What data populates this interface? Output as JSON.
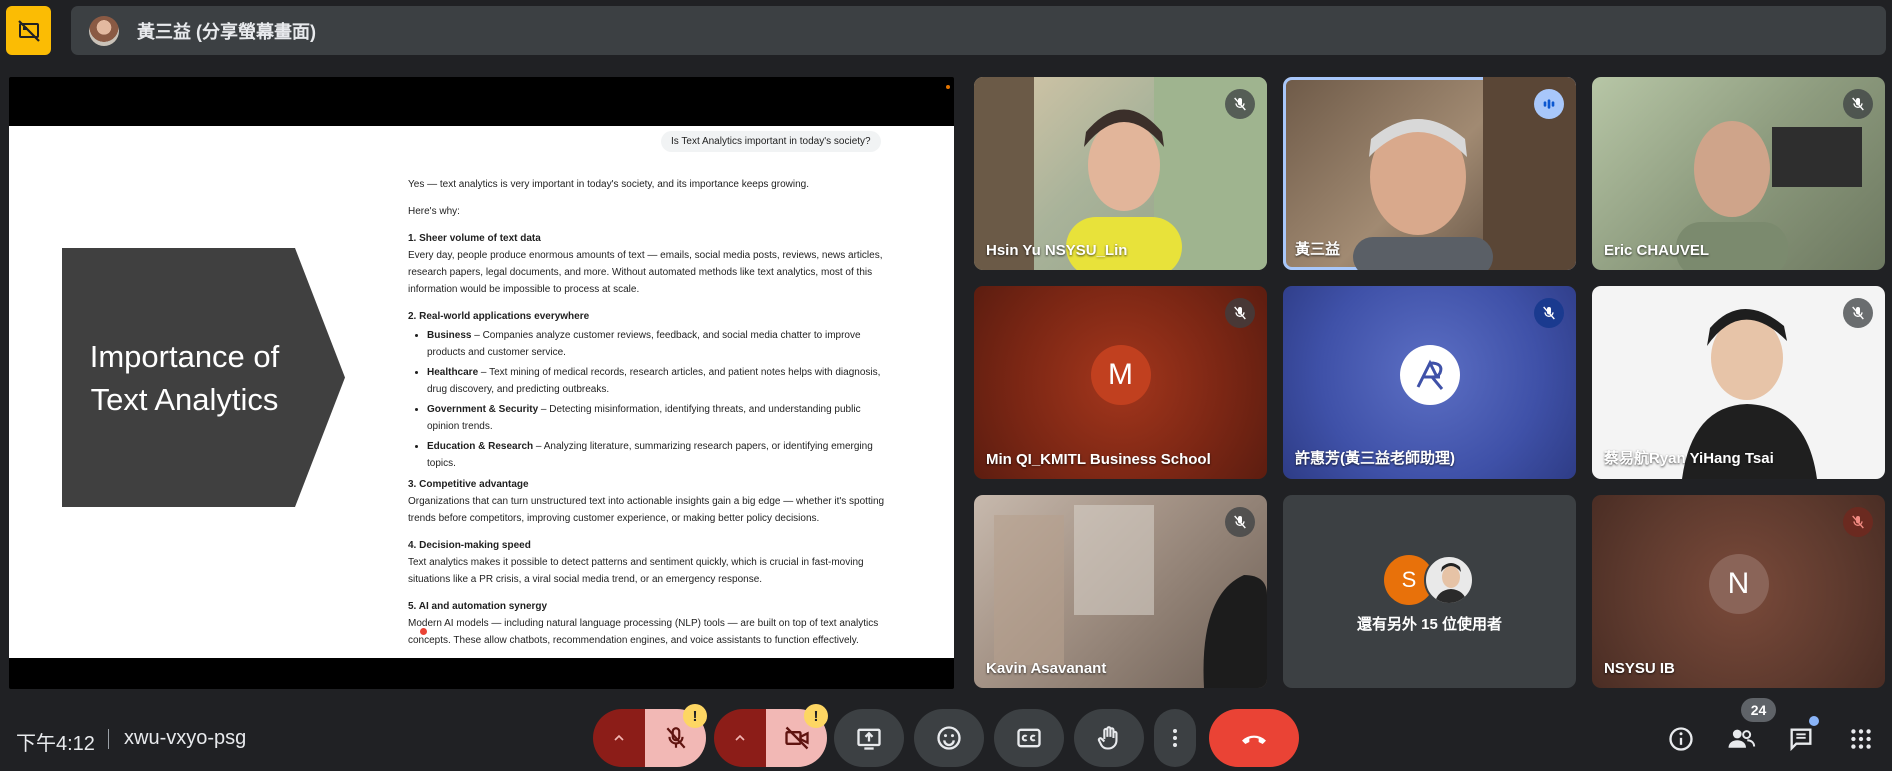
{
  "header": {
    "presenter_label": "黃三益 (分享螢幕畫面)"
  },
  "slide": {
    "title": "Importance of Text Analytics",
    "question": "Is Text Analytics important in today's society?",
    "intro": "Yes — text analytics is very important in today's society, and its importance keeps growing.",
    "why": "Here's why:",
    "sec1_title": "1. Sheer volume of text data",
    "sec1_body": "Every day, people produce enormous amounts of text — emails, social media posts, reviews, news articles, research papers, legal documents, and more. Without automated methods like text analytics, most of this information would be impossible to process at scale.",
    "sec2_title": "2. Real-world applications everywhere",
    "bullets": [
      {
        "term": "Business",
        "text": " – Companies analyze customer reviews, feedback, and social media chatter to improve products and customer service."
      },
      {
        "term": "Healthcare",
        "text": " – Text mining of medical records, research articles, and patient notes helps with diagnosis, drug discovery, and predicting outbreaks."
      },
      {
        "term": "Government & Security",
        "text": " – Detecting misinformation, identifying threats, and understanding public opinion trends."
      },
      {
        "term": "Education & Research",
        "text": " – Analyzing literature, summarizing research papers, or identifying emerging topics."
      }
    ],
    "sec3_title": "3. Competitive advantage",
    "sec3_body": "Organizations that can turn unstructured text into actionable insights gain a big edge — whether it's spotting trends before competitors, improving customer experience, or making better policy decisions.",
    "sec4_title": "4. Decision-making speed",
    "sec4_body": "Text analytics makes it possible to detect patterns and sentiment quickly, which is crucial in fast-moving situations like a PR crisis, a viral social media trend, or an emergency response.",
    "sec5_title": "5. AI and automation synergy",
    "sec5_body": "Modern AI models — including natural language processing (NLP) tools — are built on top of text analytics concepts. These allow chatbots, recommendation engines, and voice assistants to function effectively."
  },
  "participants": [
    {
      "name": "Hsin Yu NSYSU_Lin"
    },
    {
      "name": "黃三益"
    },
    {
      "name": "Eric CHAUVEL"
    },
    {
      "name": "Min QI_KMITL Business School",
      "initial": "M"
    },
    {
      "name": "許惠芳(黃三益老師助理)"
    },
    {
      "name": "蔡易航Ryan YiHang Tsai"
    },
    {
      "name": "Kavin Asavanant"
    },
    {
      "name": "還有另外 15 位使用者",
      "initial": "S"
    },
    {
      "name": "NSYSU IB",
      "initial": "N"
    }
  ],
  "footer": {
    "clock": "下午4:12",
    "meeting_code": "xwu-vxyo-psg",
    "people_count": "24",
    "warn_mark": "!"
  },
  "colors": {
    "background": "#202124",
    "accent_yellow": "#fbbc04",
    "hangup_red": "#ea4335",
    "muted_dark_red": "#8c1d18",
    "muted_light_red": "#f2b8b5",
    "speaking_blue": "#a8c7fa"
  }
}
